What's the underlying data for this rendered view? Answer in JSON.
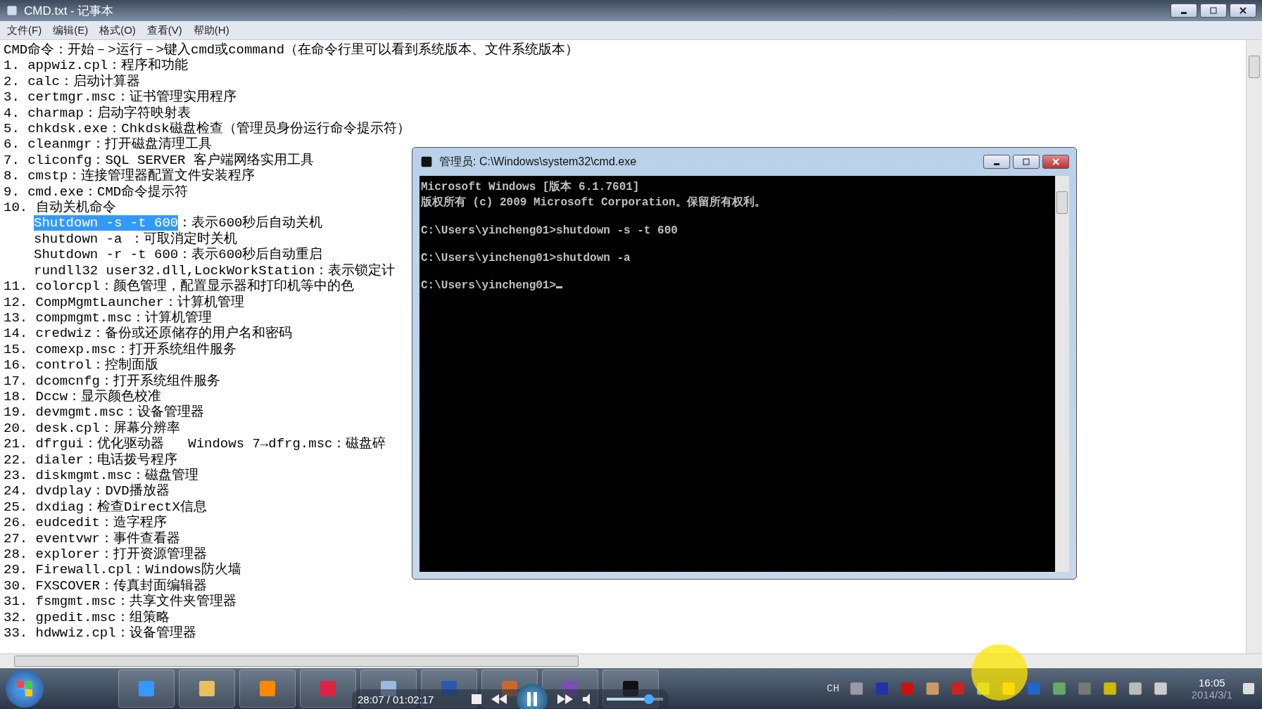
{
  "notepad": {
    "title": "CMD.txt - 记事本",
    "menu": [
      "文件(F)",
      "编辑(E)",
      "格式(O)",
      "查看(V)",
      "帮助(H)"
    ],
    "intro": "CMD命令：开始－>运行－>键入cmd或command（在命令行里可以看到系统版本、文件系统版本）",
    "items": [
      {
        "text": "1. appwiz.cpl：程序和功能"
      },
      {
        "text": "2. calc：启动计算器"
      },
      {
        "text": "3. certmgr.msc：证书管理实用程序"
      },
      {
        "text": "4. charmap：启动字符映射表"
      },
      {
        "text": "5. chkdsk.exe：Chkdsk磁盘检查（管理员身份运行命令提示符）"
      },
      {
        "text": "6. cleanmgr：打开磁盘清理工具"
      },
      {
        "text": "7. cliconfg：SQL SERVER 客户端网络实用工具"
      },
      {
        "text": "8. cmstp：连接管理器配置文件安装程序"
      },
      {
        "text": "9. cmd.exe：CMD命令提示符"
      },
      {
        "text": "10. 自动关机命令",
        "children": [
          {
            "segments": [
              {
                "text": "Shutdown -s -t 600",
                "selected": true
              },
              {
                "text": "：表示600秒后自动关机",
                "selected": false
              }
            ]
          },
          {
            "segments": [
              {
                "text": "shutdown -a ：可取消定时关机",
                "selected": false
              }
            ]
          },
          {
            "segments": [
              {
                "text": "Shutdown -r -t 600：表示600秒后自动重启",
                "selected": false
              }
            ]
          },
          {
            "segments": [
              {
                "text": "rundll32 user32.dll,LockWorkStation：表示锁定计",
                "selected": false
              }
            ]
          }
        ]
      },
      {
        "text": "11. colorcpl：颜色管理，配置显示器和打印机等中的色"
      },
      {
        "text": "12. CompMgmtLauncher：计算机管理"
      },
      {
        "text": "13. compmgmt.msc：计算机管理"
      },
      {
        "text": "14. credwiz：备份或还原储存的用户名和密码"
      },
      {
        "text": "15. comexp.msc：打开系统组件服务"
      },
      {
        "text": "16. control：控制面版"
      },
      {
        "text": "17. dcomcnfg：打开系统组件服务"
      },
      {
        "text": "18. Dccw：显示颜色校准"
      },
      {
        "text": "19. devmgmt.msc：设备管理器"
      },
      {
        "text": "20. desk.cpl：屏幕分辨率"
      },
      {
        "text": "21. dfrgui：优化驱动器   Windows 7→dfrg.msc：磁盘碎"
      },
      {
        "text": "22. dialer：电话拨号程序"
      },
      {
        "text": "23. diskmgmt.msc：磁盘管理"
      },
      {
        "text": "24. dvdplay：DVD播放器"
      },
      {
        "text": "25. dxdiag：检查DirectX信息"
      },
      {
        "text": "26. eudcedit：造字程序"
      },
      {
        "text": "27. eventvwr：事件查看器"
      },
      {
        "text": "28. explorer：打开资源管理器"
      },
      {
        "text": "29. Firewall.cpl：Windows防火墙"
      },
      {
        "text": "30. FXSCOVER：传真封面编辑器"
      },
      {
        "text": "31. fsmgmt.msc：共享文件夹管理器"
      },
      {
        "text": "32. gpedit.msc：组策略"
      },
      {
        "text": "33. hdwwiz.cpl：设备管理器"
      }
    ]
  },
  "console": {
    "title": "管理员: C:\\Windows\\system32\\cmd.exe",
    "blocks": [
      [
        "Microsoft Windows [版本 6.1.7601]",
        "版权所有 (c) 2009 Microsoft Corporation。保留所有权利。"
      ],
      [
        "C:\\Users\\yincheng01>shutdown -s -t 600"
      ],
      [
        "C:\\Users\\yincheng01>shutdown -a"
      ],
      [
        "C:\\Users\\yincheng01>"
      ]
    ]
  },
  "player": {
    "time": "28:07 / 01:02:17",
    "playing": true,
    "volume": {
      "level": 0.75
    }
  },
  "tray": {
    "language": "CH",
    "time": "16:05",
    "date": "2014/3/1"
  }
}
